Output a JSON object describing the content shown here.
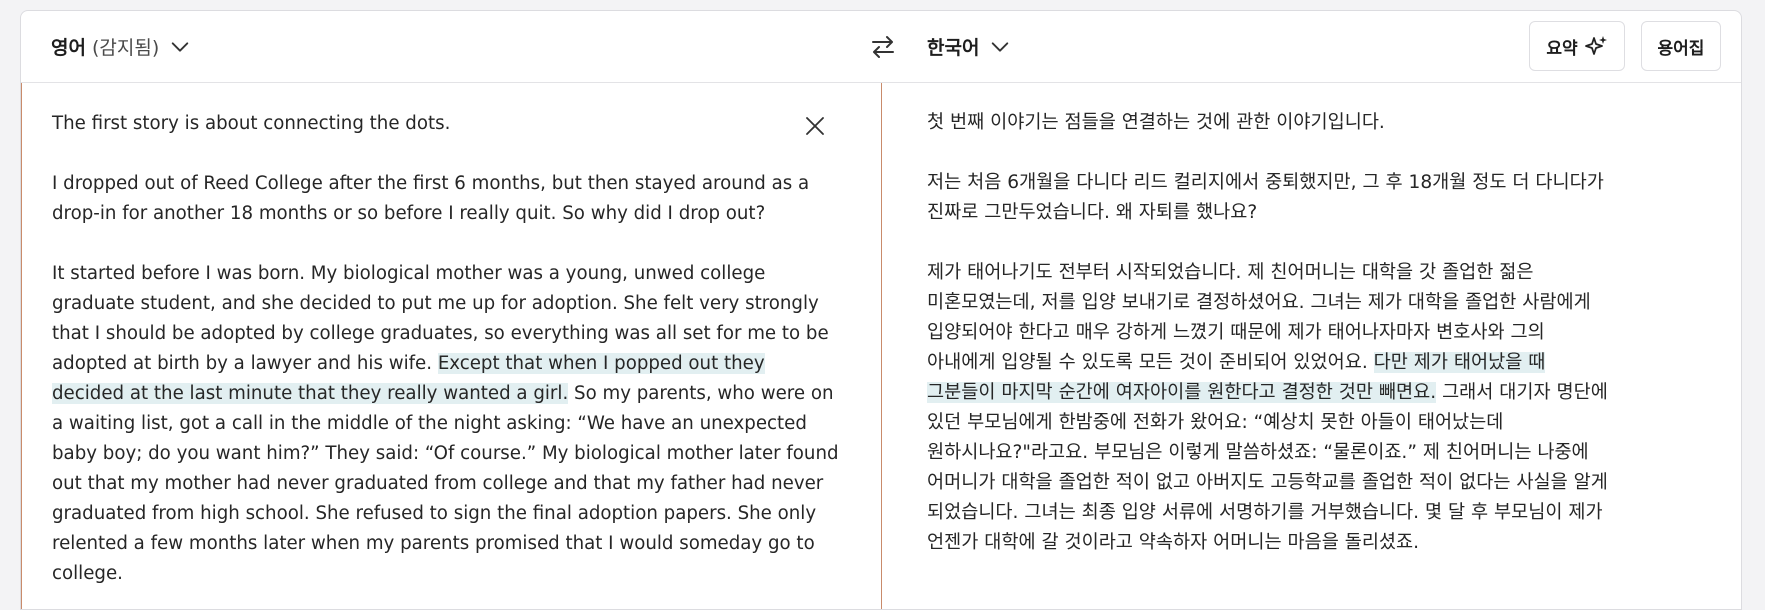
{
  "header": {
    "source_language": "영어",
    "source_detected": "(감지됨)",
    "target_language": "한국어",
    "summary_label": "요약",
    "glossary_label": "용어집"
  },
  "icons": {
    "chevron": "chevron-down-icon",
    "swap": "swap-arrows-icon",
    "sparkle": "sparkle-icon",
    "close": "close-icon"
  },
  "colors": {
    "highlight": "#e2eff1",
    "source_border": "#c98b6b"
  },
  "source": {
    "p1": [
      "The first story is about connecting the dots."
    ],
    "p2": [
      "I dropped out of Reed College after the first 6 months, but then stayed around as a",
      "drop-in for another 18 months or so before I really quit. So why did I drop out?"
    ],
    "p3": {
      "l1": "It started before I was born. My biological mother was a young, unwed college",
      "l2": "graduate student, and she decided to put me up for adoption. She felt very strongly",
      "l3": "that I should be adopted by college graduates, so everything was all set for me to be",
      "l4_pre": "adopted at birth by a lawyer and his wife. ",
      "l4_hl": "Except that when I popped out they",
      "l5_hl": "decided at the last minute that they really wanted a girl.",
      "l5_post": " So my parents, who were on",
      "l6": "a waiting list, got a call in the middle of the night asking: “We have an unexpected",
      "l7": "baby boy; do you want him?” They said: “Of course.” My biological mother later found",
      "l8": "out that my mother had never graduated from college and that my father had never",
      "l9": "graduated from high school. She refused to sign the final adoption papers. She only",
      "l10": "relented a few months later when my parents promised that I would someday go to",
      "l11": "college."
    }
  },
  "target": {
    "p1": [
      "첫 번째 이야기는 점들을 연결하는 것에 관한 이야기입니다."
    ],
    "p2": [
      "저는 처음 6개월을 다니다 리드 컬리지에서 중퇴했지만, 그 후 18개월 정도 더 다니다가",
      "진짜로 그만두었습니다. 왜 자퇴를 했나요?"
    ],
    "p3": {
      "l1": "제가 태어나기도 전부터 시작되었습니다. 제 친어머니는 대학을 갓 졸업한 젊은",
      "l2": "미혼모였는데, 저를 입양 보내기로 결정하셨어요. 그녀는 제가 대학을 졸업한 사람에게",
      "l3": "입양되어야 한다고 매우 강하게 느꼈기 때문에 제가 태어나자마자 변호사와 그의",
      "l4_pre": "아내에게 입양될 수 있도록 모든 것이 준비되어 있었어요. ",
      "l4_hl": "다만 제가 태어났을 때",
      "l5_hl": "그분들이 마지막 순간에 여자아이를 원한다고 결정한 것만 빼면요.",
      "l5_post": " 그래서 대기자 명단에",
      "l6": "있던 부모님에게 한밤중에 전화가 왔어요: “예상치 못한 아들이 태어났는데",
      "l7": "원하시나요?\"라고요. 부모님은 이렇게 말씀하셨죠: “물론이죠.” 제 친어머니는 나중에",
      "l8": "어머니가 대학을 졸업한 적이 없고 아버지도 고등학교를 졸업한 적이 없다는 사실을 알게",
      "l9": "되었습니다. 그녀는 최종 입양 서류에 서명하기를 거부했습니다. 몇 달 후 부모님이 제가",
      "l10": "언젠가 대학에 갈 것이라고 약속하자 어머니는 마음을 돌리셨죠."
    }
  }
}
